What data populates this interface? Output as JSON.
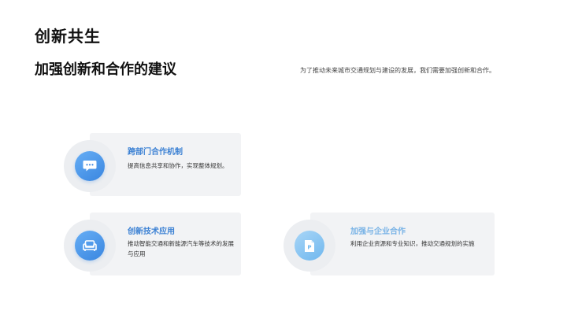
{
  "slide": {
    "title": "创新共生",
    "subtitle": "加强创新和合作的建议",
    "description": "为了推动未来城市交通规划与建设的发展，我们需要加强创新和合作。"
  },
  "cards": [
    {
      "title": "跨部门合作机制",
      "text": "提高信息共享和协作，实现整体规划。",
      "icon": "chat-bubble-icon",
      "color": "#3d82d4"
    },
    {
      "title": "创新技术应用",
      "text": "推动智能交通和新能源汽车等技术的发展与应用",
      "icon": "sofa-icon",
      "color": "#3d82d4"
    },
    {
      "title": "加强与企业合作",
      "text": "利用企业资源和专业知识，推动交通规划的实施",
      "icon": "document-p-icon",
      "color": "#79b3e6"
    }
  ]
}
